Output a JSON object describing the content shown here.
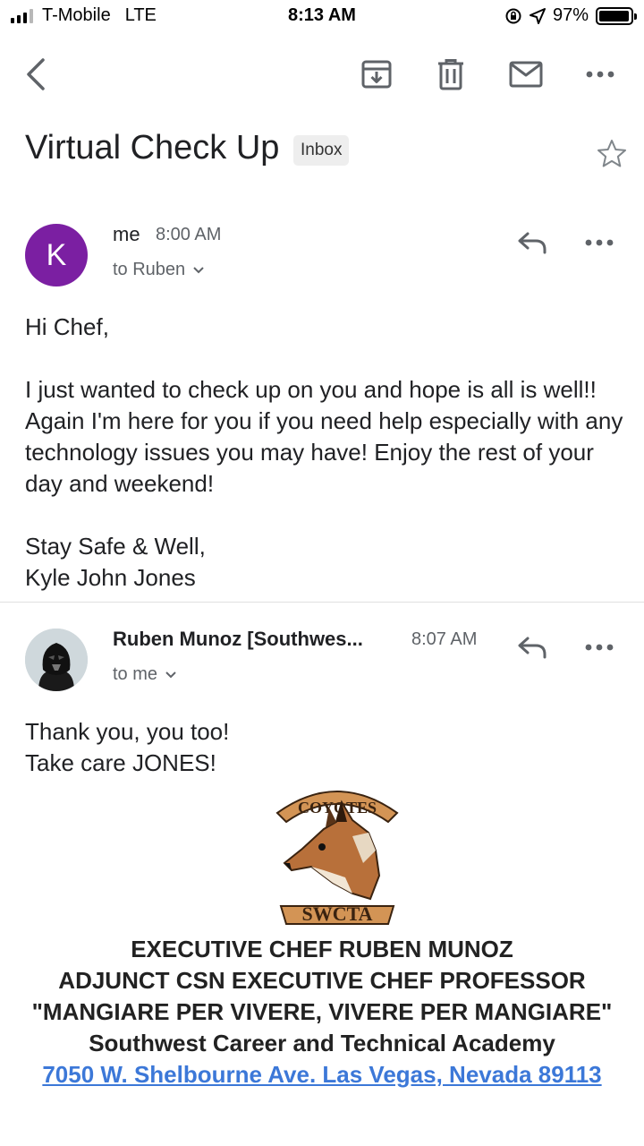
{
  "status_bar": {
    "carrier": "T-Mobile",
    "network": "LTE",
    "time": "8:13 AM",
    "battery": "97%",
    "battery_level": 0.97
  },
  "toolbar": {
    "icons": [
      "back-arrow-icon",
      "archive-icon",
      "trash-icon",
      "mail-icon",
      "more-icon"
    ]
  },
  "thread": {
    "subject": "Virtual Check Up",
    "label": "Inbox"
  },
  "messages": [
    {
      "avatar_letter": "K",
      "avatar_color": "#7b1fa2",
      "sender": "me",
      "time": "8:00 AM",
      "to": "to Ruben",
      "body": [
        "Hi Chef,",
        "I just wanted to check up on you and hope is all is well!! Again I'm here for you if you need help especially with any technology issues you may have! Enjoy the rest of your day and weekend!",
        "Stay Safe & Well,",
        "Kyle John Jones"
      ]
    },
    {
      "sender": "Ruben Munoz [Southwes...",
      "time": "8:07 AM",
      "to": "to me",
      "body": [
        "Thank you, you too!",
        "Take care JONES!"
      ],
      "logo": {
        "top_text": "COYOTES",
        "bottom_text": "SWCTA"
      },
      "signature": [
        "EXECUTIVE CHEF RUBEN MUNOZ",
        "ADJUNCT CSN EXECUTIVE CHEF PROFESSOR",
        "\"MANGIARE PER VIVERE, VIVERE PER MANGIARE\"",
        "Southwest Career and Technical Academy"
      ],
      "address": "7050 W. Shelbourne Ave. Las Vegas, Nevada 89113"
    }
  ]
}
